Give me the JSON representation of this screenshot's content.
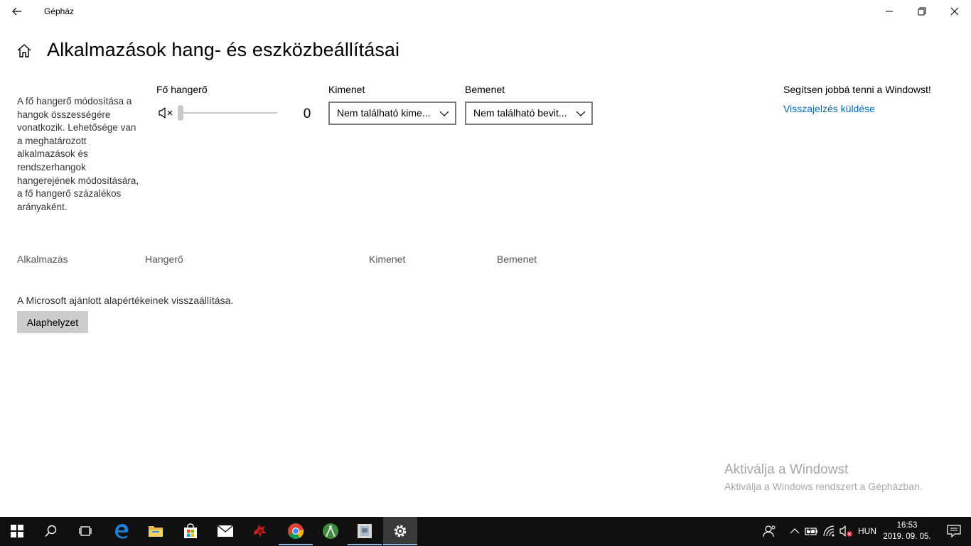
{
  "window": {
    "title": "Gépház"
  },
  "header": {
    "page_title": "Alkalmazások hang- és eszközbeállításai"
  },
  "description": "A fő hangerő módosítása a hangok összességére vonatkozik. Lehetősége van a meghatározott alkalmazások és rendszerhangok hangerejének módosítására, a fő hangerő százalékos arányaként.",
  "master_volume": {
    "label": "Fő hangerő",
    "value": "0",
    "level_percent": 0,
    "muted": true
  },
  "output": {
    "label": "Kimenet",
    "selected": "Nem található kime..."
  },
  "input": {
    "label": "Bemenet",
    "selected": "Nem található bevit..."
  },
  "feedback": {
    "heading": "Segítsen jobbá tenni a Windowst!",
    "link": "Visszajelzés küldése"
  },
  "table": {
    "columns": [
      "Alkalmazás",
      "Hangerő",
      "Kimenet",
      "Bemenet"
    ]
  },
  "reset": {
    "text": "A Microsoft ajánlott alapértékeinek visszaállítása.",
    "button_label": "Alaphelyzet"
  },
  "watermark": {
    "title": "Aktiválja a Windowst",
    "subtitle": "Aktiválja a Windows rendszert a Gépházban."
  },
  "taskbar": {
    "apps": [
      "start-icon",
      "search-icon",
      "task-view-icon",
      "edge-icon",
      "file-explorer-icon",
      "store-icon",
      "mail-icon",
      "game-icon",
      "chrome-icon",
      "android-studio-icon",
      "app-icon",
      "settings-icon"
    ],
    "active_app": "settings-icon",
    "language": "HUN",
    "time": "16:53",
    "date": "2019. 09. 05."
  },
  "colors": {
    "accent_link": "#0067b8",
    "taskbar_bg": "#101010",
    "button_bg": "#cccccc"
  }
}
